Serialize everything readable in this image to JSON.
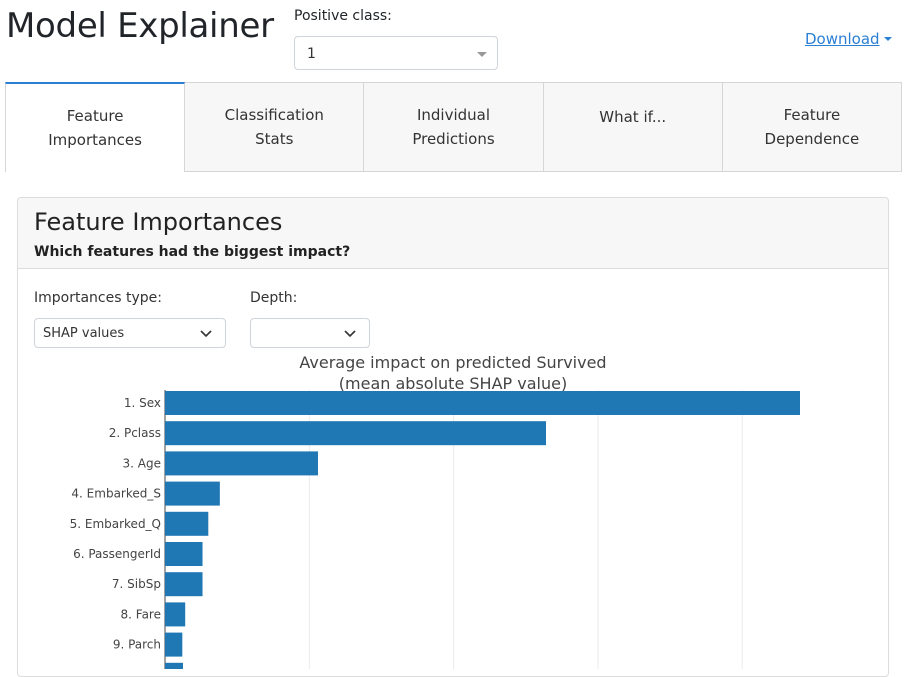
{
  "app": {
    "title": "Model Explainer",
    "positive_class_label": "Positive class:",
    "positive_class_value": "1",
    "download_label": "Download"
  },
  "tabs": [
    {
      "label": "Feature Importances",
      "active": true
    },
    {
      "label": "Classification Stats",
      "active": false
    },
    {
      "label": "Individual Predictions",
      "active": false
    },
    {
      "label": "What if...",
      "active": false
    },
    {
      "label": "Feature Dependence",
      "active": false
    }
  ],
  "card": {
    "title": "Feature Importances",
    "subtitle": "Which features had the biggest impact?",
    "importances_type_label": "Importances type:",
    "importances_type_value": "SHAP values",
    "depth_label": "Depth:",
    "depth_value": ""
  },
  "colors": {
    "accent": "#2a7fd4",
    "bar": "#1f77b4"
  },
  "chart_data": {
    "type": "bar",
    "orientation": "horizontal",
    "title": "Average impact on predicted Survived",
    "subtitle": "(mean absolute SHAP value)",
    "categories": [
      "1. Sex",
      "2. Pclass",
      "3. Age",
      "4. Embarked_S",
      "5. Embarked_Q",
      "6. PassengerId",
      "7. SibSp",
      "8. Fare",
      "9. Parch"
    ],
    "values": [
      0.22,
      0.132,
      0.053,
      0.019,
      0.015,
      0.013,
      0.013,
      0.007,
      0.006
    ],
    "xlim": [
      0,
      0.25
    ],
    "grid": true,
    "gridlines": [
      0.05,
      0.1,
      0.15,
      0.2
    ]
  }
}
